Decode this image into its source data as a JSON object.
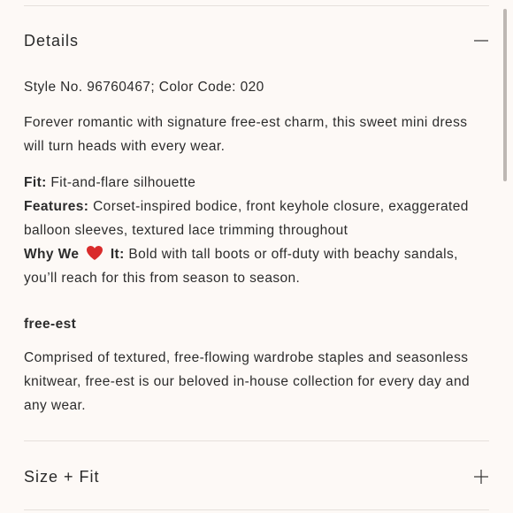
{
  "details": {
    "title": "Details",
    "expanded": true,
    "toggle_icon": "minus-icon",
    "style_line": "Style No. 96760467; Color Code: 020",
    "intro": "Forever romantic with signature free-est charm, this sweet mini dress will turn heads with every wear.",
    "fit_label": "Fit:",
    "fit_value": " Fit-and-flare silhouette",
    "features_label": "Features:",
    "features_value": " Corset-inspired bodice, front keyhole closure, exaggerated balloon sleeves, textured lace trimming throughout",
    "why_label_1": "Why We",
    "why_heart_icon": "red-heart-icon",
    "why_label_2": "It:",
    "why_value": " Bold with tall boots or off-duty with beachy sandals, you’ll reach for this from season to season.",
    "brand_heading": "free-est",
    "brand_text": "Comprised of textured, free-flowing wardrobe staples and seasonless knitwear, free-est is our beloved in-house collection for every day and any wear."
  },
  "size_fit": {
    "title": "Size + Fit",
    "expanded": false,
    "toggle_icon": "plus-icon"
  },
  "colors": {
    "background": "#fdf9f6",
    "divider": "#e6e0dc",
    "text": "#2a2a2a",
    "heart": "#d92b2b"
  }
}
